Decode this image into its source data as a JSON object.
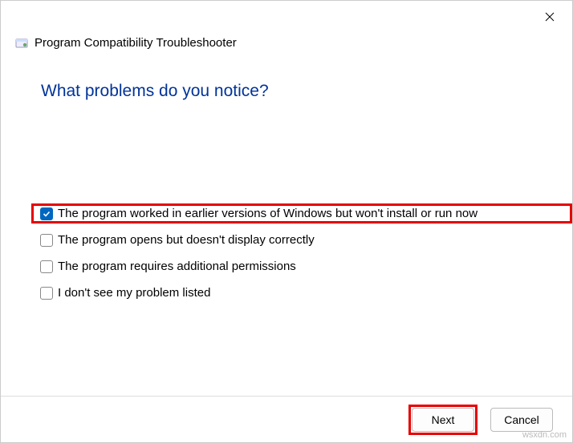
{
  "header": {
    "title": "Program Compatibility Troubleshooter"
  },
  "heading": "What problems do you notice?",
  "options": [
    {
      "label": "The program worked in earlier versions of Windows but won't install or run now",
      "checked": true,
      "highlight": true
    },
    {
      "label": "The program opens but doesn't display correctly",
      "checked": false,
      "highlight": false
    },
    {
      "label": "The program requires additional permissions",
      "checked": false,
      "highlight": false
    },
    {
      "label": "I don't see my problem listed",
      "checked": false,
      "highlight": false
    }
  ],
  "footer": {
    "next": "Next",
    "cancel": "Cancel"
  },
  "watermark": "wsxdn.com"
}
